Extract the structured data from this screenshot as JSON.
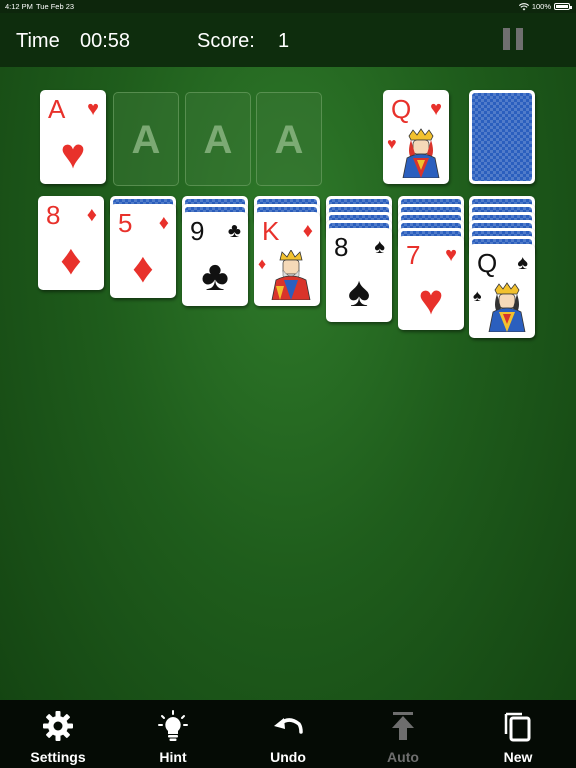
{
  "status": {
    "time": "4:12 PM",
    "date": "Tue Feb 23",
    "battery": "100%"
  },
  "header": {
    "time_label": "Time",
    "time_value": "00:58",
    "score_label": "Score:",
    "score_value": "1"
  },
  "foundations": [
    {
      "rank": "A",
      "suit": "♥",
      "color": "red"
    },
    {
      "placeholder": "A"
    },
    {
      "placeholder": "A"
    },
    {
      "placeholder": "A"
    }
  ],
  "waste": {
    "rank": "Q",
    "suit": "♥",
    "color": "red"
  },
  "tableau": [
    {
      "hidden": 0,
      "rank": "8",
      "suit": "♦",
      "color": "red"
    },
    {
      "hidden": 1,
      "rank": "5",
      "suit": "♦",
      "color": "red"
    },
    {
      "hidden": 2,
      "rank": "9",
      "suit": "♣",
      "color": "black"
    },
    {
      "hidden": 3,
      "rank": "K",
      "suit": "♦",
      "color": "red"
    },
    {
      "hidden": 4,
      "rank": "8",
      "suit": "♠",
      "color": "black"
    },
    {
      "hidden": 5,
      "rank": "7",
      "suit": "♥",
      "color": "red"
    },
    {
      "hidden": 6,
      "rank": "Q",
      "suit": "♠",
      "color": "black"
    }
  ],
  "toolbar": {
    "settings": "Settings",
    "hint": "Hint",
    "undo": "Undo",
    "auto": "Auto",
    "new": "New"
  },
  "colors": {
    "felt": "#1f5d1c",
    "card_back": "#2b5fbe",
    "red_suit": "#e8312b"
  }
}
